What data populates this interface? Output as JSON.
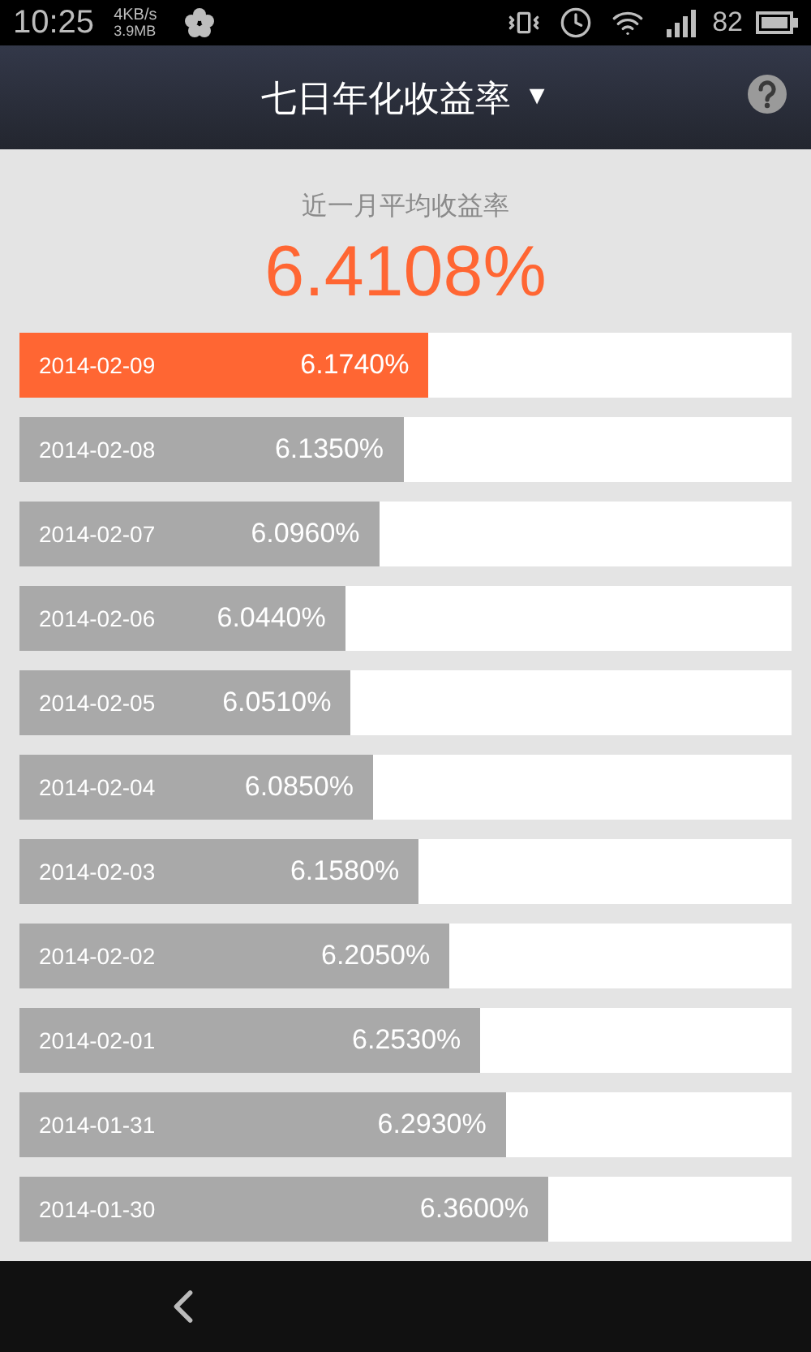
{
  "status_bar": {
    "time": "10:25",
    "net_speed": "4KB/s",
    "net_total": "3.9MB",
    "battery": "82"
  },
  "header": {
    "title": "七日年化收益率",
    "dropdown": "▼"
  },
  "summary": {
    "label": "近一月平均收益率",
    "value": "6.4108%"
  },
  "rows": [
    {
      "date": "2014-02-09",
      "rate": "6.1740%",
      "level": 0.53,
      "selected": true
    },
    {
      "date": "2014-02-08",
      "rate": "6.1350%",
      "level": 0.497,
      "selected": false
    },
    {
      "date": "2014-02-07",
      "rate": "6.0960%",
      "level": 0.466,
      "selected": false
    },
    {
      "date": "2014-02-06",
      "rate": "6.0440%",
      "level": 0.422,
      "selected": false
    },
    {
      "date": "2014-02-05",
      "rate": "6.0510%",
      "level": 0.429,
      "selected": false
    },
    {
      "date": "2014-02-04",
      "rate": "6.0850%",
      "level": 0.458,
      "selected": false
    },
    {
      "date": "2014-02-03",
      "rate": "6.1580%",
      "level": 0.517,
      "selected": false
    },
    {
      "date": "2014-02-02",
      "rate": "6.2050%",
      "level": 0.557,
      "selected": false
    },
    {
      "date": "2014-02-01",
      "rate": "6.2530%",
      "level": 0.597,
      "selected": false
    },
    {
      "date": "2014-01-31",
      "rate": "6.2930%",
      "level": 0.63,
      "selected": false
    },
    {
      "date": "2014-01-30",
      "rate": "6.3600%",
      "level": 0.685,
      "selected": false
    }
  ]
}
